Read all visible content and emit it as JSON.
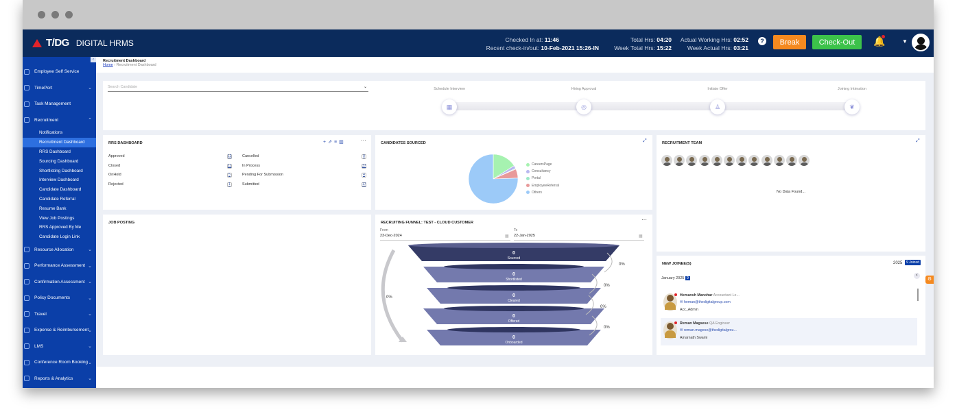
{
  "app": {
    "brand": "T/DG",
    "name": "DIGITAL HRMS"
  },
  "topbar": {
    "checked_in_label": "Checked In at:",
    "checked_in_value": "11:46",
    "recent_label": "Recent check-in/out:",
    "recent_value": "10-Feb-2021 15:26-IN",
    "total_hrs_label": "Total Hrs:",
    "total_hrs_value": "04:20",
    "week_total_label": "Week Total Hrs:",
    "week_total_value": "15:22",
    "actual_working_label": "Actual Working Hrs:",
    "actual_working_value": "02:52",
    "week_actual_label": "Week Actual Hrs:",
    "week_actual_value": "03:21",
    "break_label": "Break",
    "checkout_label": "Check-Out",
    "help_icon": "help-circle-icon",
    "bell_icon": "bell-icon"
  },
  "sidebar": {
    "items": [
      {
        "label": "Employee Self Service",
        "icon": "user-icon",
        "chevron": false
      },
      {
        "label": "TimePort",
        "icon": "clock-icon",
        "chevron": true
      },
      {
        "label": "Task Management",
        "icon": "task-icon",
        "chevron": false
      },
      {
        "label": "Recruitment",
        "icon": "recruit-icon",
        "chevron": true
      }
    ],
    "sub_items": [
      "Notifications",
      "Recruitment Dashboard",
      "RRS Dashboard",
      "Sourcing Dashboard",
      "Shortlisting Dashboard",
      "Interview Dashboard",
      "Candidate Dashboard",
      "Candidate Referral",
      "Resume Bank",
      "View Job Postings",
      "RRS Approved By Me",
      "Candidate Login Link"
    ],
    "active_sub": "Recruitment Dashboard",
    "items_after": [
      {
        "label": "Resource Allocation",
        "icon": "resource-icon"
      },
      {
        "label": "Performance Assessment",
        "icon": "performance-icon"
      },
      {
        "label": "Confirmation Assessment",
        "icon": "confirm-icon"
      },
      {
        "label": "Policy Documents",
        "icon": "document-icon"
      },
      {
        "label": "Travel",
        "icon": "travel-icon"
      },
      {
        "label": "Expense & Reimbursement",
        "icon": "expense-icon"
      },
      {
        "label": "LMS",
        "icon": "lms-icon"
      },
      {
        "label": "Conference Room Booking",
        "icon": "room-icon"
      },
      {
        "label": "Reports & Analytics",
        "icon": "reports-icon"
      }
    ]
  },
  "breadcrumb": {
    "title": "Recruitment Dashboard",
    "home": "Home",
    "current": "Recruitment Dashboard"
  },
  "search": {
    "placeholder": "Search Candidate"
  },
  "steps": [
    "Schedule Interview",
    "Hiring Approval",
    "Initiate Offer",
    "Joining Intimation"
  ],
  "rrs": {
    "title": "RRS DASHBOARD",
    "left": [
      {
        "label": "Approved",
        "value": "12"
      },
      {
        "label": "Closed",
        "value": "11"
      },
      {
        "label": "OnHold",
        "value": "5"
      },
      {
        "label": "Rejected",
        "value": "1"
      }
    ],
    "right": [
      {
        "label": "Cancelled",
        "value": "0"
      },
      {
        "label": "In Process",
        "value": "37"
      },
      {
        "label": "Pending For Submission",
        "value": "4"
      },
      {
        "label": "Submitted",
        "value": "17"
      }
    ]
  },
  "candidates_sourced": {
    "title": "CANDIDATES SOURCED",
    "legend": [
      {
        "label": "CareersPage",
        "color": "#a6f2b0"
      },
      {
        "label": "Consultancy",
        "color": "#b8b8f0"
      },
      {
        "label": "Portal",
        "color": "#9ce8c8"
      },
      {
        "label": "EmployeeReferral",
        "color": "#e89a9a"
      },
      {
        "label": "Others",
        "color": "#9ccaf8"
      }
    ]
  },
  "team": {
    "title": "RECRUITMENT TEAM",
    "empty": "No Data Found..."
  },
  "job_posting": {
    "title": "JOB POSTING"
  },
  "funnel": {
    "title": "RECRUITING FUNNEL: TEST - CLOUD CUSTOMER",
    "from_label": "From",
    "from_value": "23-Dec-2024",
    "to_label": "To",
    "to_value": "22-Jan-2025",
    "stages": [
      {
        "value": "0",
        "label": "Sourced"
      },
      {
        "value": "0",
        "label": "Shortlisted"
      },
      {
        "value": "0",
        "label": "Cleared"
      },
      {
        "value": "0",
        "label": "Offered"
      },
      {
        "value": "0",
        "label": "Onboarded"
      }
    ],
    "conversion": [
      "0%",
      "0%",
      "0%",
      "0%"
    ],
    "overall": "0%"
  },
  "new_joinee": {
    "title": "NEW JOINEE(S)",
    "year": "2025",
    "joined_badge": "9 Joined",
    "month": "January",
    "month_year": "2025",
    "month_count": "9",
    "people": [
      {
        "name": "Hemansh Manohar",
        "role": "Accountant Le...",
        "email": "heman@thedigitalgroup.com",
        "manager": "Acc_Admin"
      },
      {
        "name": "Reman Magsese",
        "role": "QA Engineer",
        "email": "reman.magese@thedigitalgrou...",
        "manager": "Amarnath Swami"
      }
    ]
  },
  "chart_data": [
    {
      "type": "pie",
      "title": "CANDIDATES SOURCED",
      "categories": [
        "CareersPage",
        "Consultancy",
        "Portal",
        "EmployeeReferral",
        "Others"
      ],
      "values": [
        16,
        2,
        0.5,
        6,
        75.5
      ]
    },
    {
      "type": "bar",
      "title": "RECRUITING FUNNEL: TEST - CLOUD CUSTOMER",
      "categories": [
        "Sourced",
        "Shortlisted",
        "Cleared",
        "Offered",
        "Onboarded"
      ],
      "values": [
        0,
        0,
        0,
        0,
        0
      ]
    }
  ]
}
